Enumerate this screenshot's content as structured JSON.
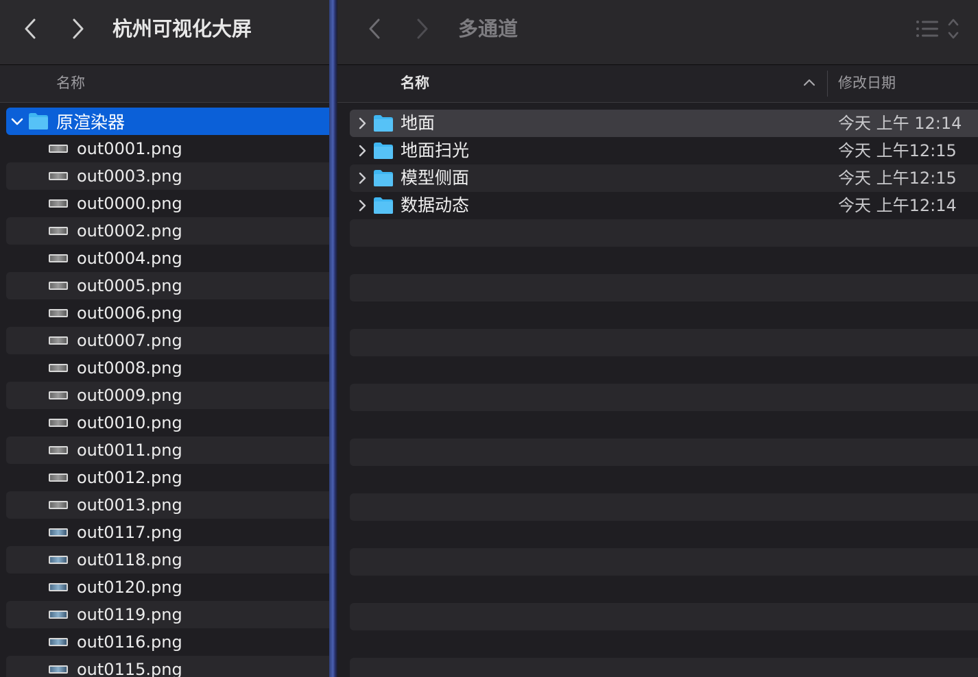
{
  "left_window": {
    "title": "杭州可视化大屏",
    "column_name": "名称",
    "folder": {
      "name": "原渲染器",
      "expanded": true,
      "selected": true
    },
    "files": [
      "out0001.png",
      "out0003.png",
      "out0000.png",
      "out0002.png",
      "out0004.png",
      "out0005.png",
      "out0006.png",
      "out0007.png",
      "out0008.png",
      "out0009.png",
      "out0010.png",
      "out0011.png",
      "out0012.png",
      "out0013.png",
      "out0117.png",
      "out0118.png",
      "out0120.png",
      "out0119.png",
      "out0116.png",
      "out0115.png"
    ]
  },
  "right_window": {
    "title": "多通道",
    "column_name": "名称",
    "column_date": "修改日期",
    "rows": [
      {
        "name": "地面",
        "date": "今天 上午 12:14"
      },
      {
        "name": "地面扫光",
        "date": "今天 上午12:15"
      },
      {
        "name": "模型侧面",
        "date": "今天 上午12:15"
      },
      {
        "name": "数据动态",
        "date": "今天 上午12:14"
      }
    ]
  },
  "colors": {
    "selection": "#0b60d8",
    "folder_blue": "#3fb6f2",
    "window_bg": "#1f1e22"
  },
  "icons": {
    "back": "chevron-left-icon",
    "forward": "chevron-right-icon",
    "folder": "folder-icon",
    "file": "png-file-icon",
    "list_view": "list-view-icon",
    "sort": "chevron-up-icon"
  }
}
